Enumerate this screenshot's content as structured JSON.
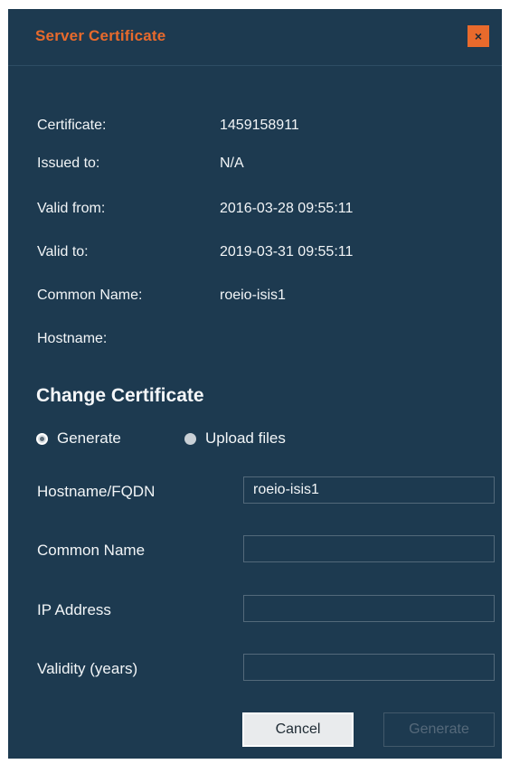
{
  "dialog": {
    "title": "Server Certificate",
    "close_label": "×"
  },
  "info": [
    {
      "label": "Certificate:",
      "value": "1459158911"
    },
    {
      "label": "Issued to:",
      "value": "N/A"
    },
    {
      "label": "Valid from:",
      "value": "2016-03-28 09:55:11"
    },
    {
      "label": "Valid to:",
      "value": "2019-03-31 09:55:11"
    },
    {
      "label": "Common Name:",
      "value": "roeio-isis1"
    },
    {
      "label": "Hostname:",
      "value": ""
    }
  ],
  "change": {
    "title": "Change Certificate",
    "options": [
      {
        "label": "Generate",
        "selected": true
      },
      {
        "label": "Upload files",
        "selected": false
      }
    ]
  },
  "form": {
    "fields": [
      {
        "label": "Hostname/FQDN",
        "value": "roeio-isis1"
      },
      {
        "label": "Common Name",
        "value": ""
      },
      {
        "label": "IP Address",
        "value": ""
      },
      {
        "label": "Validity (years)",
        "value": ""
      }
    ]
  },
  "buttons": {
    "cancel_label": "Cancel",
    "generate_label": "Generate"
  },
  "colors": {
    "dialog_bg": "#1d3a50",
    "accent": "#e86a2c",
    "text": "#f2f5f7"
  }
}
